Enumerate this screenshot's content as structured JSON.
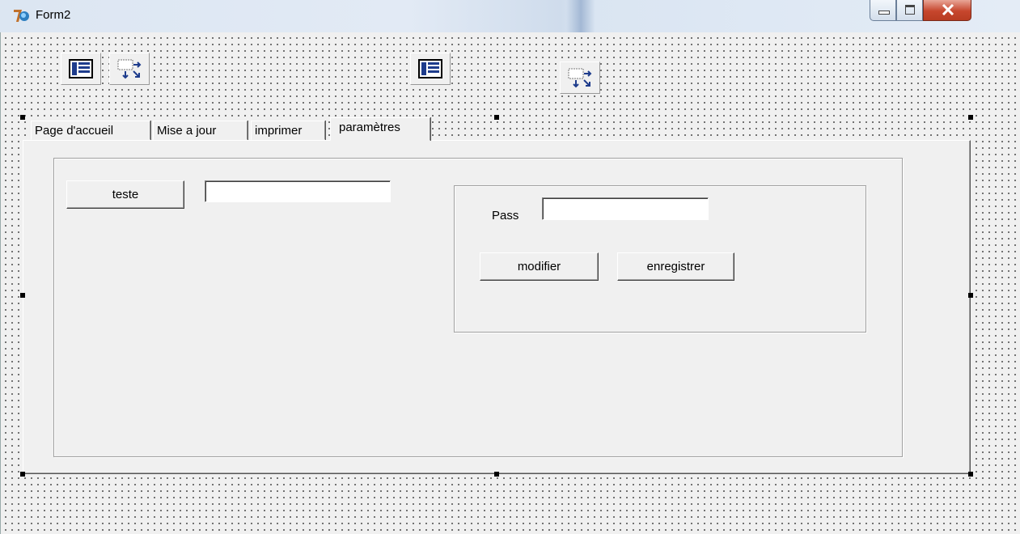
{
  "window": {
    "title": "Form2",
    "icon": "delphi-app-icon",
    "controls": [
      "minimize-icon",
      "maximize-icon",
      "close-icon"
    ]
  },
  "toolbar_components": [
    {
      "icon": "table-grid-icon"
    },
    {
      "icon": "data-source-icon"
    },
    {
      "icon": "table-grid-icon"
    },
    {
      "icon": "data-source-icon"
    }
  ],
  "tabs": [
    {
      "label": "Page d'accueil",
      "active": false
    },
    {
      "label": "Mise a jour",
      "active": false
    },
    {
      "label": "imprimer",
      "active": false
    },
    {
      "label": "paramètres",
      "active": true
    }
  ],
  "form": {
    "teste_button": "teste",
    "teste_input": {
      "value": ""
    },
    "pass_label": "Pass",
    "pass_input": {
      "value": ""
    },
    "modifier_button": "modifier",
    "enregistrer_button": "enregistrer"
  },
  "colors": {
    "face": "#f0f0f0",
    "close_button": "#c6462d",
    "grid_dot": "#000000"
  }
}
